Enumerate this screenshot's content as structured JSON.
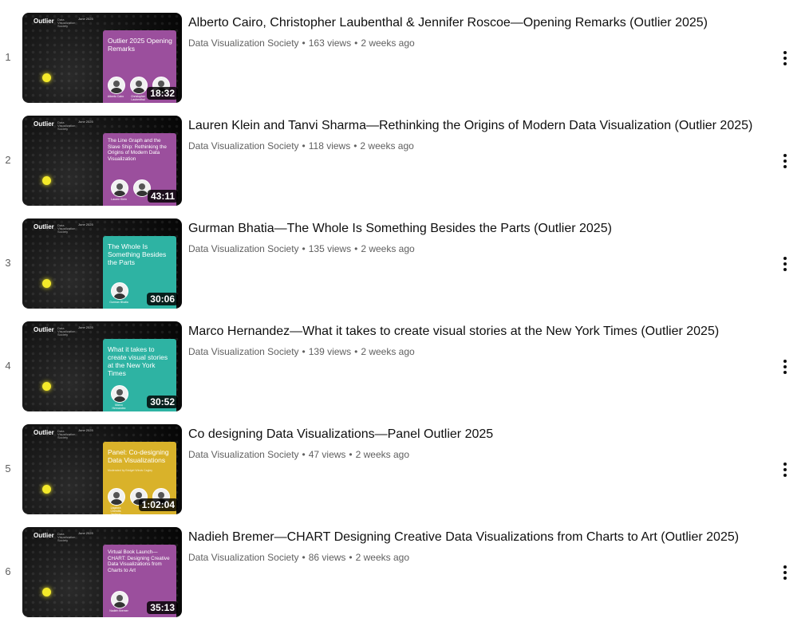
{
  "videos": [
    {
      "index": "1",
      "title": "Alberto Cairo, Christopher Laubenthal & Jennifer Roscoe—Opening Remarks (Outlier 2025)",
      "channel": "Data Visualization Society",
      "views": "163 views",
      "age": "2 weeks ago",
      "duration": "18:32",
      "thumb_title": "Outlier 2025 Opening Remarks",
      "panel_color": "#9b4f9d",
      "speakers": [
        "Alberto Cairo",
        "Christopher Laubenthal",
        ""
      ]
    },
    {
      "index": "2",
      "title": "Lauren Klein and Tanvi Sharma—Rethinking the Origins of Modern Data Visualization (Outlier 2025)",
      "channel": "Data Visualization Society",
      "views": "118 views",
      "age": "2 weeks ago",
      "duration": "43:11",
      "thumb_title": "The Line Graph and the Slave Ship: Rethinking the Origins of Modern Data Visualization",
      "panel_color": "#9b4f9d",
      "speakers": [
        "Lauren Klein",
        ""
      ]
    },
    {
      "index": "3",
      "title": "Gurman Bhatia—The Whole Is Something Besides the Parts (Outlier 2025)",
      "channel": "Data Visualization Society",
      "views": "135 views",
      "age": "2 weeks ago",
      "duration": "30:06",
      "thumb_title": "The Whole Is Something Besides the Parts",
      "panel_color": "#2eb3a3",
      "speakers": [
        "Gurman Bhatia"
      ]
    },
    {
      "index": "4",
      "title": "Marco Hernandez—What it takes to create visual stories at the New York Times (Outlier 2025)",
      "channel": "Data Visualization Society",
      "views": "139 views",
      "age": "2 weeks ago",
      "duration": "30:52",
      "thumb_title": "What it takes to create visual stories at the New York Times",
      "panel_color": "#2eb3a3",
      "speakers": [
        "Marco Hernandez"
      ]
    },
    {
      "index": "5",
      "title": "Co designing Data Visualizations—Panel Outlier 2025",
      "channel": "Data Visualization Society",
      "views": "47 views",
      "age": "2 weeks ago",
      "duration": "1:02:04",
      "thumb_title": "Panel: Co-designing Data Visualizations",
      "thumb_sub": "Moderated by Bridget Winds Cagley",
      "panel_color": "#d9b22a",
      "speakers": [
        "Lagdora Cherotis Jackson",
        "",
        ""
      ]
    },
    {
      "index": "6",
      "title": "Nadieh Bremer—CHART Designing Creative Data Visualizations from Charts to Art (Outlier 2025)",
      "channel": "Data Visualization Society",
      "views": "86 views",
      "age": "2 weeks ago",
      "duration": "35:13",
      "thumb_title": "Virtual Book Launch— CHART: Designing Creative Data Visualizations from Charts to Art",
      "panel_color": "#9b4f9d",
      "speakers": [
        "Nadieh Bremer"
      ]
    }
  ],
  "thumb_brand": {
    "logo": "Outlier",
    "sub": "Data Visualization Society",
    "date": "June 2025"
  },
  "colors": {
    "text": "#0f0f0f",
    "meta": "#606060",
    "highlight_dot": "#f4ea2a"
  },
  "icons": {
    "menu": "more-vert-icon"
  }
}
